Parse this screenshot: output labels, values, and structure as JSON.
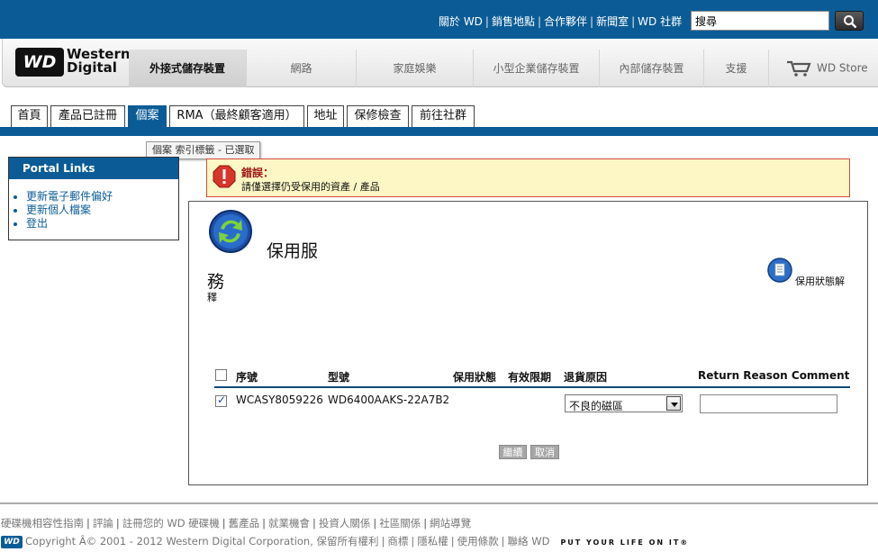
{
  "header": {
    "links": [
      "關於 WD",
      "銷售地點",
      "合作夥伴",
      "新聞室",
      "WD 社群"
    ],
    "search_value": "搜尋"
  },
  "nav": {
    "logo_short": "WD",
    "logo_line1": "Western",
    "logo_line2": "Digital",
    "items": [
      "外接式儲存裝置",
      "網路",
      "家庭娛樂",
      "小型企業儲存裝置",
      "內部儲存裝置",
      "支援"
    ],
    "store": "WD Store"
  },
  "tabs": {
    "items": [
      "首頁",
      "產品已註冊",
      "個案",
      "RMA（最終顧客適用）",
      "地址",
      "保修檢查",
      "前往社群"
    ],
    "tooltip": "個案 索引標籤 - 已選取"
  },
  "portal": {
    "title": "Portal Links",
    "links": [
      "更新電子郵件偏好",
      "更新個人檔案",
      "登出"
    ]
  },
  "error": {
    "title": "錯誤：",
    "message": "請僅選擇仍受保用的資產 / 產品"
  },
  "panel": {
    "title_line1": "保用服",
    "title_line2": "務",
    "title_line3": "釋",
    "status_help": "保用狀態解",
    "columns": [
      "序號",
      "型號",
      "保用狀態",
      "有效限期",
      "退貨原因",
      "Return Reason Comment"
    ],
    "row": {
      "checked": true,
      "serial": "WCASY8059226",
      "model": "WD6400AAKS-22A7B2",
      "warranty_status": "",
      "expiry": "",
      "reason": "不良的磁區",
      "comment": ""
    },
    "continue_label": "繼續",
    "cancel_label": "取消"
  },
  "footer": {
    "links": [
      "硬碟機相容性指南",
      "評論",
      "註冊您的 WD 硬碟機",
      "舊產品",
      "就業機會",
      "投資人關係",
      "社區關係",
      "網站導覽"
    ],
    "copyright": "Copyright Â© 2001 - 2012 Western Digital Corporation, 保留所有權利",
    "links2": [
      "商標",
      "隱私權",
      "使用條款",
      "聯絡 WD"
    ],
    "tagline": "PUT YOUR LIFE ON IT®"
  },
  "colors": {
    "brand_blue": "#0b5c96",
    "error_bg": "#fdf7c5",
    "error_border": "#d24a3c"
  }
}
